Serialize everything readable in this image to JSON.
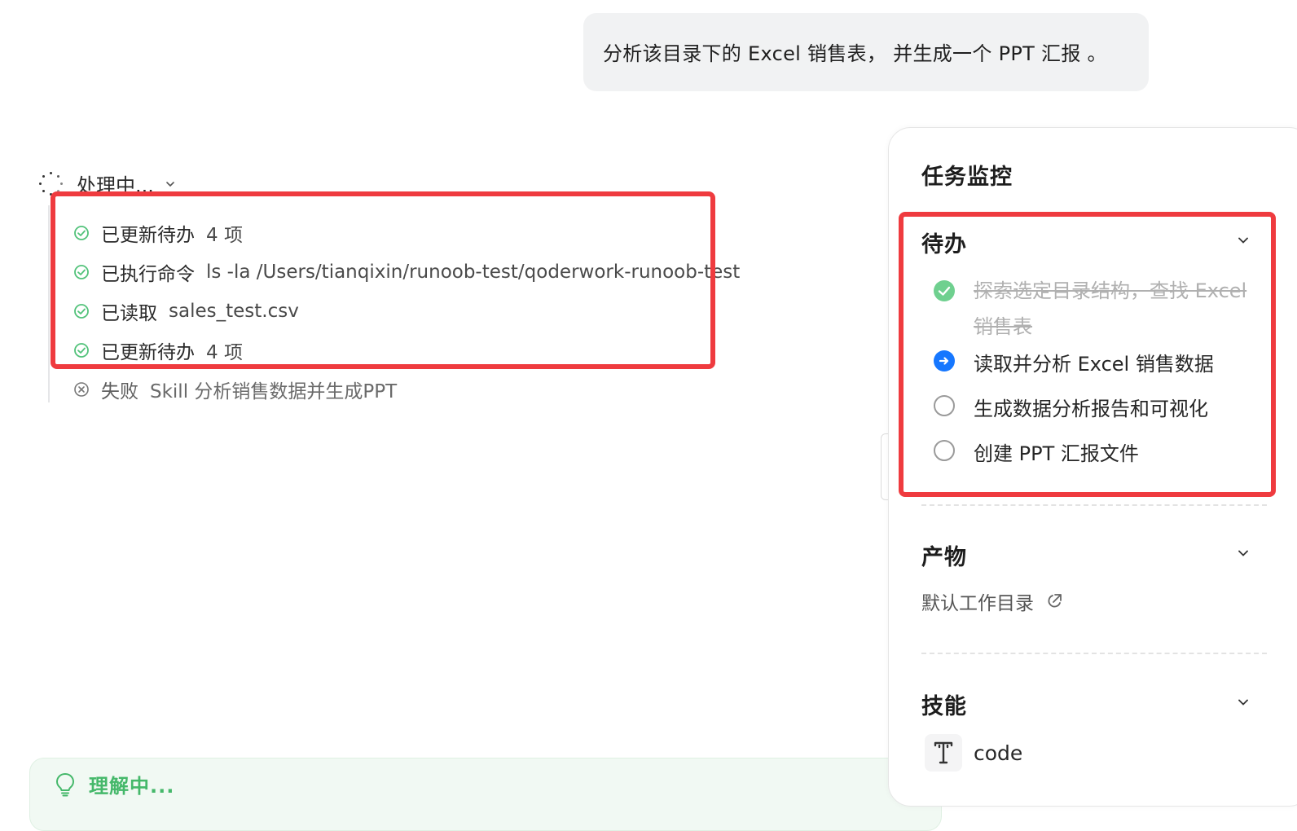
{
  "user_message": "分析该目录下的 Excel 销售表， 并生成一个 PPT 汇报 。",
  "process": {
    "status_label": "处理中...",
    "steps": [
      {
        "label": "已更新待办",
        "detail": "4 项",
        "status": "success"
      },
      {
        "label": "已执行命令",
        "detail": "ls -la /Users/tianqixin/runoob-test/qoderwork-runoob-test",
        "status": "success"
      },
      {
        "label": "已读取",
        "detail": "sales_test.csv",
        "status": "success"
      },
      {
        "label": "已更新待办",
        "detail": "4 项",
        "status": "success"
      },
      {
        "label": "失败",
        "detail": "Skill  分析销售数据并生成PPT",
        "status": "failed"
      }
    ]
  },
  "thinking": {
    "label": "理解中..."
  },
  "toggle": {
    "glyph": "›"
  },
  "monitor": {
    "title": "任务监控",
    "todo": {
      "title": "待办",
      "items": [
        {
          "text": "探索选定目录结构，查找 Excel 销售表",
          "status": "done"
        },
        {
          "text": "读取并分析 Excel 销售数据",
          "status": "in-progress"
        },
        {
          "text": "生成数据分析报告和可视化",
          "status": "pending"
        },
        {
          "text": "创建 PPT 汇报文件",
          "status": "pending"
        }
      ]
    },
    "artifacts": {
      "title": "产物",
      "item": "默认工作目录"
    },
    "skills": {
      "title": "技能",
      "item": "code"
    }
  },
  "colors": {
    "success": "#52c27a",
    "active": "#1677ff",
    "highlight": "#ef3b3f",
    "thinking": "#45b86a"
  },
  "icons": {
    "spinner": "loading-spinner-icon",
    "success": "check-circle-icon",
    "failed": "x-circle-icon",
    "chevron": "chevron-down-icon",
    "bulb": "lightbulb-icon",
    "done": "check-filled-icon",
    "active": "arrow-right-circle-icon",
    "pending": "empty-circle-icon",
    "external": "external-link-icon",
    "skill": "text-tool-icon"
  }
}
